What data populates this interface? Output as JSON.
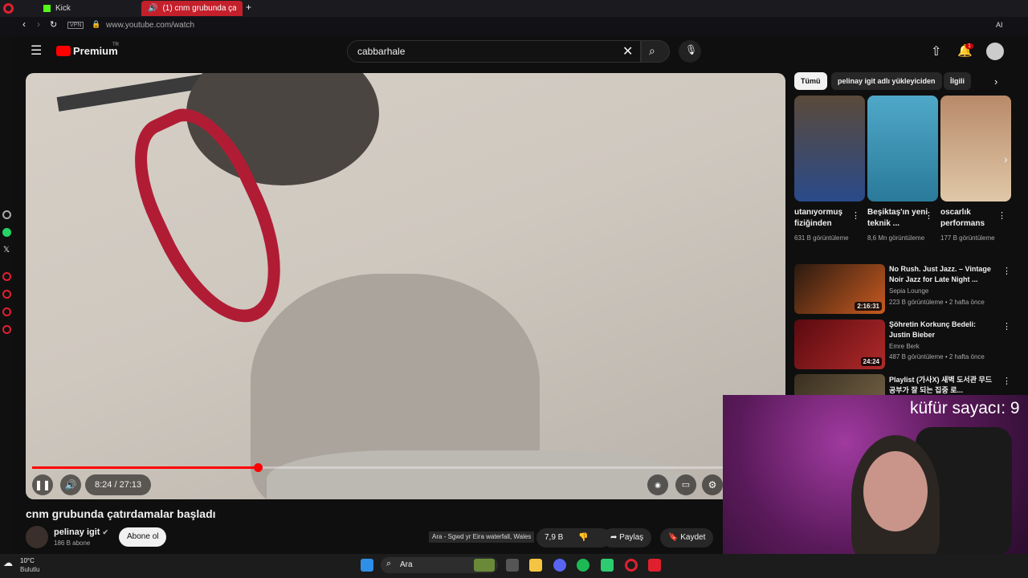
{
  "browser": {
    "tabs": [
      {
        "label": "Kick"
      },
      {
        "label": "(1) cnm grubunda çat..."
      }
    ],
    "vpn_label": "VPN",
    "url": "www.youtube.com/watch",
    "ai_label": "AI"
  },
  "youtube": {
    "logo_text": "Premium",
    "logo_region": "TR",
    "search_value": "cabbarhale",
    "notification_count": "1"
  },
  "player": {
    "time": "8:24 / 27:13",
    "progress": 0.31
  },
  "video": {
    "title": "cnm grubunda çatırdamalar başladı",
    "channel": "pelinay igit",
    "subscribers": "186 B abone",
    "subscribe_label": "Abone ol",
    "likes": "7,9 B",
    "share_label": "Paylaş",
    "save_label": "Kaydet",
    "tooltip": "Ara - Sgwd yr Eira waterfall, Wales"
  },
  "chips": [
    {
      "label": "Tümü"
    },
    {
      "label": "pelinay igit adlı yükleyiciden"
    },
    {
      "label": "İlgili"
    }
  ],
  "shorts": [
    {
      "title": "utanıyormuş fiziğinden",
      "views": "631 B görüntüleme"
    },
    {
      "title": "Beşiktaş'ın yeni teknik ...",
      "views": "8,6 Mn görüntüleme"
    },
    {
      "title": "oscarlık performans",
      "views": "177 B görüntüleme"
    }
  ],
  "recommendations": [
    {
      "title": "No Rush. Just Jazz. – Vintage Noir Jazz for Late Night ...",
      "channel": "Sepia Lounge",
      "meta": "223 B görüntüleme • 2 hafta önce",
      "duration": "2:16:31"
    },
    {
      "title": "Şöhretin Korkunç Bedeli: Justin Bieber",
      "channel": "Emre Berk",
      "meta": "487 B görüntüleme • 2 hafta önce",
      "duration": "24:24"
    },
    {
      "title": "Playlist (가사X) 새벽 도서관 무드 공부가 잘 되는 집중 로..."
    }
  ],
  "overlay": {
    "counter": "küfür sayacı: 9"
  },
  "taskbar": {
    "temperature": "10°C",
    "weather": "Bulutlu",
    "search_placeholder": "Ara"
  },
  "colors": {
    "accent": "#ff0000",
    "background": "#0f0f0f",
    "opera": "#e0202f"
  }
}
